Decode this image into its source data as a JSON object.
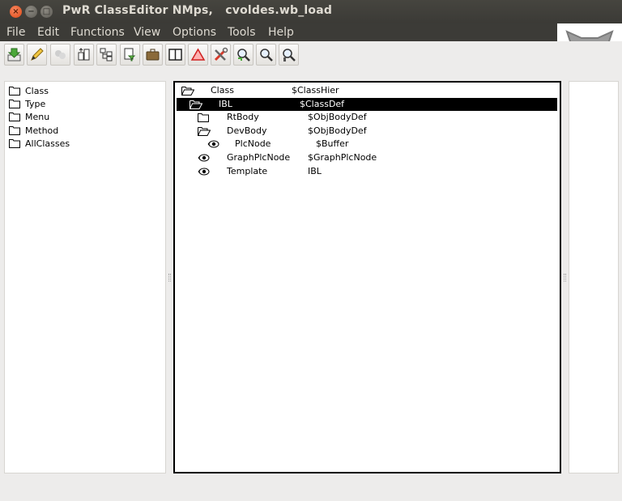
{
  "window": {
    "title": "PwR ClassEditor NMps,   cvoldes.wb_load",
    "buttons": {
      "close": "×",
      "minimize": "−",
      "maximize": "□"
    }
  },
  "menu": [
    "File",
    "Edit",
    "Functions",
    "View",
    "Options",
    "Tools",
    "Help"
  ],
  "toolbar": [
    {
      "name": "save-icon"
    },
    {
      "name": "edit-icon"
    },
    {
      "name": "disabled-tool-icon"
    },
    {
      "name": "object-up-icon"
    },
    {
      "name": "object-hierarchy-icon"
    },
    {
      "name": "filter-icon"
    },
    {
      "name": "briefcase-icon"
    },
    {
      "name": "book-icon"
    },
    {
      "name": "warning-icon"
    },
    {
      "name": "tools-icon"
    },
    {
      "name": "zoom-in-icon"
    },
    {
      "name": "zoom-out-icon"
    },
    {
      "name": "zoom-reset-icon"
    }
  ],
  "left_tree": [
    {
      "label": "Class"
    },
    {
      "label": "Type"
    },
    {
      "label": "Menu"
    },
    {
      "label": "Method"
    },
    {
      "label": "AllClasses"
    }
  ],
  "center_tree": [
    {
      "name": "Class",
      "class": "$ClassHier",
      "icon": "folder-open",
      "level": 0,
      "selected": false
    },
    {
      "name": "IBL",
      "class": "$ClassDef",
      "icon": "folder-open",
      "level": 1,
      "selected": true
    },
    {
      "name": "RtBody",
      "class": "$ObjBodyDef",
      "icon": "folder",
      "level": 2,
      "selected": false
    },
    {
      "name": "DevBody",
      "class": "$ObjBodyDef",
      "icon": "folder-open",
      "level": 2,
      "selected": false
    },
    {
      "name": "PlcNode",
      "class": "$Buffer",
      "icon": "eye",
      "level": 3,
      "selected": false
    },
    {
      "name": "GraphPlcNode",
      "class": "$GraphPlcNode",
      "icon": "eye",
      "level": 2,
      "selected": false
    },
    {
      "name": "Template",
      "class": "IBL",
      "icon": "eye",
      "level": 2,
      "selected": false
    }
  ]
}
